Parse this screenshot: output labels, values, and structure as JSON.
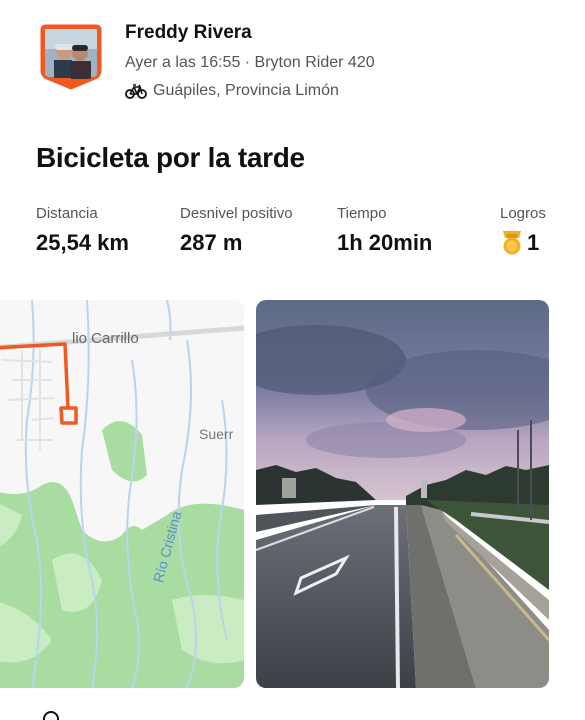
{
  "athlete": {
    "name": "Freddy Rivera",
    "meta": "Ayer a las 16:55 · Bryton Rider 420",
    "location": "Guápiles, Provincia Limón",
    "avatar_icon": "profile-photo-badge",
    "sport_icon": "bicycle-icon"
  },
  "activity": {
    "title": "Bicicleta por la tarde"
  },
  "stats": {
    "distance": {
      "label": "Distancia",
      "value": "25,54 km"
    },
    "elevation": {
      "label": "Desnivel positivo",
      "value": "287 m"
    },
    "time": {
      "label": "Tiempo",
      "value": "1h 20min"
    },
    "achievements": {
      "label": "Logros",
      "value": "1",
      "icon": "medal-icon"
    }
  },
  "map": {
    "road_label": "lio Carrillo",
    "town_label": "Suerr",
    "river_label": "Río Cristina",
    "route_color": "#f05a22"
  },
  "photo": {
    "icon": "road-photo"
  },
  "colors": {
    "accent": "#fc5200",
    "medal": "#f2b01e"
  }
}
